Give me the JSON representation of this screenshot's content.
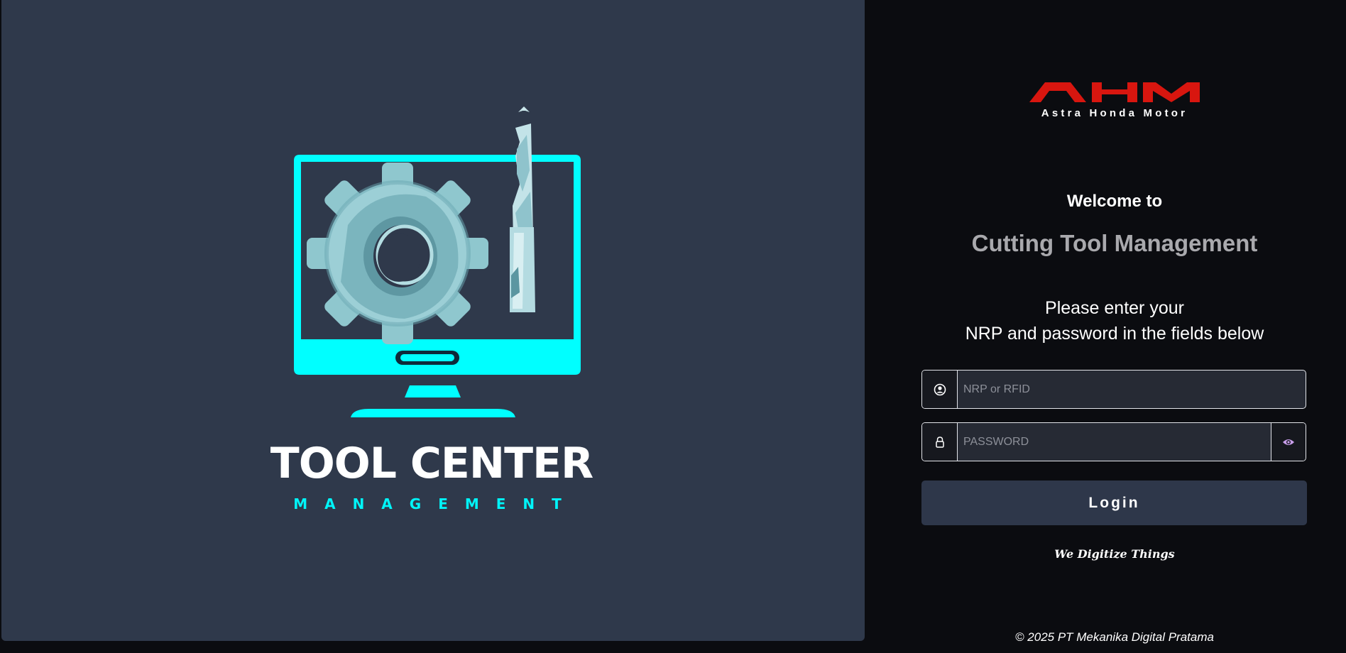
{
  "left_panel": {
    "brand_title": "TOOL CENTER",
    "brand_subtitle": "MANAGEMENT"
  },
  "header": {
    "logo_text": "AHM",
    "logo_caption": "Astra Honda Motor"
  },
  "login": {
    "welcome": "Welcome to",
    "app_name": "Cutting Tool Management",
    "instruction_line1": "Please enter your",
    "instruction_line2": "NRP and password in the fields below",
    "nrp_placeholder": "NRP or RFID",
    "password_placeholder": "PASSWORD",
    "login_label": "Login",
    "tagline": "We Digitize Things"
  },
  "footer": {
    "copyright": "© 2025 PT Mekanika Digital Pratama"
  },
  "icons": {
    "user": "user-circle-icon",
    "lock": "lock-icon",
    "eye": "eye-icon"
  },
  "colors": {
    "left_panel_bg": "#2f394b",
    "right_panel_bg": "#0b0c10",
    "accent_cyan": "#00f4f8",
    "ahm_red": "#d8160f",
    "button_bg": "#2e374a",
    "eye_icon": "#c79de8"
  }
}
